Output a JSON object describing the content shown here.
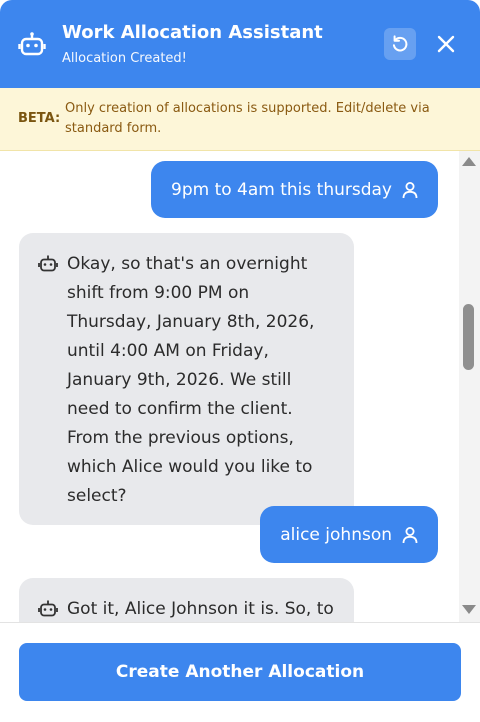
{
  "header": {
    "title": "Work Allocation Assistant",
    "subtitle": "Allocation Created!",
    "icons": {
      "bot": "bot-icon",
      "reset": "refresh-icon",
      "close": "close-icon"
    },
    "color": "#3d86ee"
  },
  "beta": {
    "label": "BETA:",
    "text": "Only creation of allocations is supported. Edit/delete via standard form."
  },
  "messages": [
    {
      "role": "user",
      "text": "9pm to 4am this thursday"
    },
    {
      "role": "assistant",
      "text": "Okay, so that's an overnight shift from 9:00 PM on Thursday, January 8th, 2026, until 4:00 AM on Friday, January 9th, 2026. We still need to confirm the client. From the previous options, which Alice would you like to select?"
    },
    {
      "role": "user",
      "text": "alice johnson"
    },
    {
      "role": "assistant",
      "text": "Got it, Alice Johnson it is. So, to"
    }
  ],
  "footer": {
    "button_label": "Create Another Allocation"
  }
}
